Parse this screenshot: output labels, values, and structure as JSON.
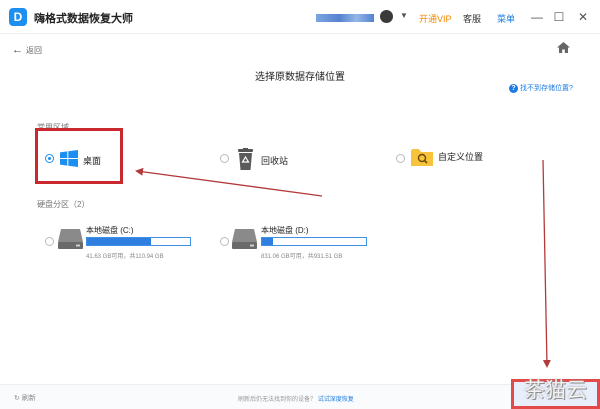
{
  "app": {
    "title": "嗨格式数据恢复大师",
    "logo_letter": "D"
  },
  "titlebar": {
    "vip": "开通VIP",
    "support": "客服",
    "menu": "菜单"
  },
  "nav": {
    "back": "返回"
  },
  "page": {
    "title": "选择原数据存储位置",
    "help": "找不到存储位置?"
  },
  "common": {
    "label": "常用区域",
    "items": [
      {
        "label": "桌面",
        "icon": "windows-icon",
        "selected": true
      },
      {
        "label": "回收站",
        "icon": "recycle-bin-icon",
        "selected": false
      },
      {
        "label": "自定义位置",
        "icon": "folder-search-icon",
        "selected": false
      }
    ]
  },
  "partitions": {
    "label": "硬盘分区（2）",
    "drives": [
      {
        "name": "本地磁盘 (C:)",
        "size_text": "41.63 GB可用，共110.94 GB",
        "used_fraction": 0.62
      },
      {
        "name": "本地磁盘 (D:)",
        "size_text": "831.06 GB可用，共931.51 GB",
        "used_fraction": 0.11
      }
    ]
  },
  "footer": {
    "refresh": "刷新",
    "hint": "刷新后仍无法找到你的设备？",
    "hint_link": "试试深度恢复"
  },
  "watermark": "茶猫云",
  "colors": {
    "accent": "#1c8ff0",
    "annotation": "#c8282e",
    "vip": "#f08a00"
  }
}
